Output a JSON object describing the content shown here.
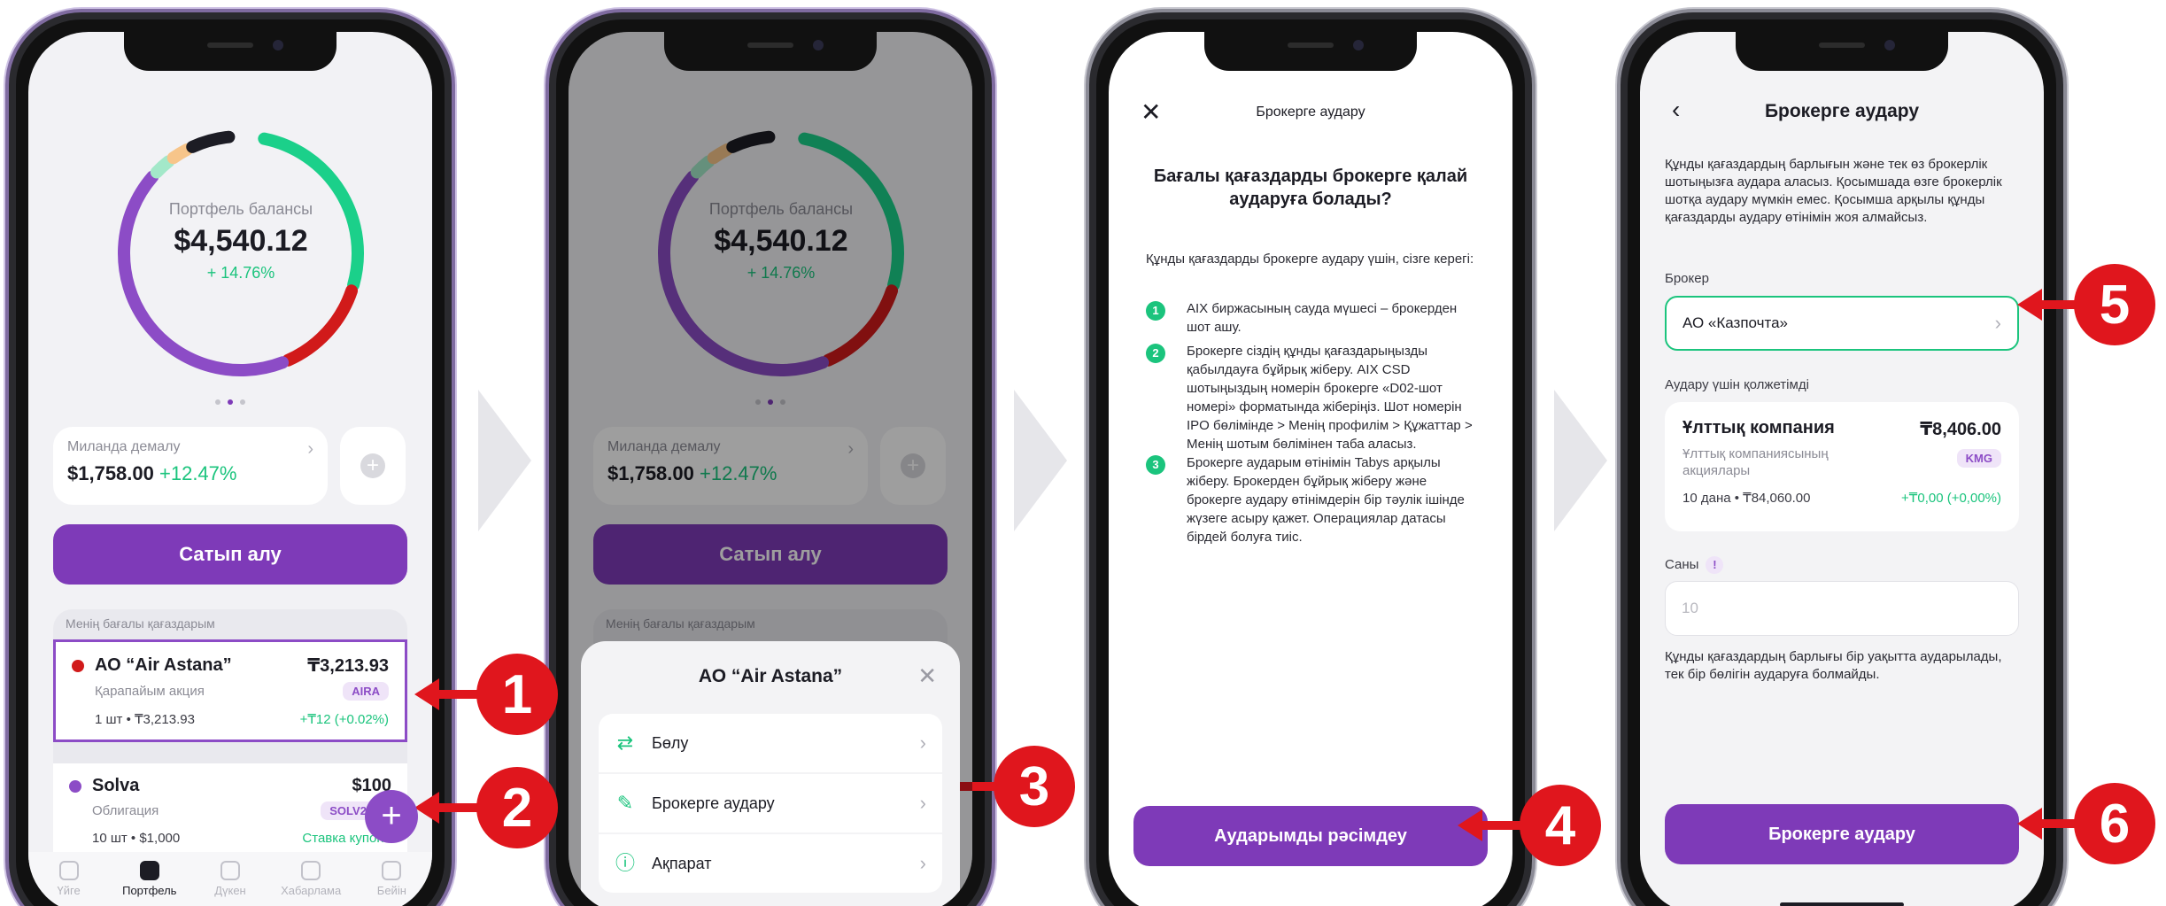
{
  "screen1": {
    "balance_label": "Портфель балансы",
    "balance_value": "$4,540.12",
    "balance_change": "+ 14.76%",
    "donut_segments": [
      {
        "color": "#1bd08a",
        "fraction": 0.27
      },
      {
        "color": "#d11a1a",
        "fraction": 0.14
      },
      {
        "color": "#8c4cc6",
        "fraction": 0.43
      },
      {
        "color": "#a3e8c9",
        "fraction": 0.03
      },
      {
        "color": "#f7c58a",
        "fraction": 0.03
      },
      {
        "color": "#1c1c24",
        "fraction": 0.06
      }
    ],
    "milanda_label": "Миланда демалу",
    "milanda_value": "$1,758.00",
    "milanda_change": "+12.47%",
    "buy_button": "Сатып алу",
    "section_title": "Менің бағалы қағаздарым",
    "items": [
      {
        "name": "АО “Air Astana”",
        "price": "₸3,213.93",
        "type": "Қарапайым акция",
        "tag": "AIRA",
        "qty": "1 шт • ₸3,213.93",
        "gain": "+₸12 (+0.02%)",
        "dot_color": "#d11a1a"
      },
      {
        "name": "Solva",
        "price": "$100",
        "type": "Облигация",
        "tag": "SOLV2.02",
        "qty": "10 шт • $1,000",
        "gain": "Ставка купона",
        "dot_color": "#8c4cc6"
      }
    ],
    "tabs": [
      "Үйге",
      "Портфель",
      "Дүкен",
      "Хабарлама",
      "Бейін"
    ]
  },
  "screen2": {
    "sheet_title": "АО “Air Astana”",
    "options": [
      {
        "label": "Бөлу",
        "icon": "shuffle-icon"
      },
      {
        "label": "Брокерге аудару",
        "icon": "edit-icon"
      },
      {
        "label": "Ақпарат",
        "icon": "info-icon"
      }
    ]
  },
  "screen3": {
    "title": "Брокерге аудару",
    "heading": "Бағалы қағаздарды брокерге қалай аударуға болады?",
    "intro": "Құнды қағаздарды брокерге аудару үшін, сізге керегі:",
    "steps": [
      "AIX биржасының сауда мүшесі – брокерден шот ашу.",
      "Брокерге сіздің құнды қағаздарыңызды қабылдауға бұйрық жіберу. AIX CSD шотыңыздың номерін брокерге «D02-шот номері» форматында жіберіңіз. Шот номерін IPO бөлімінде > Менің профилім > Құжаттар > Менің шотым бөлімінен таба аласыз.",
      "Брокерге аударым өтінімін Tabys арқылы жіберу. Брокерден бұйрық жіберу және брокерге аудару өтінімдерін бір тәулік ішінде жүзеге асыру қажет. Операциялар датасы бірдей болуға тиіс."
    ],
    "button": "Аударымды рәсімдеу"
  },
  "screen4": {
    "title": "Брокерге аудару",
    "description": "Құнды қағаздардың барлығын және тек өз брокерлік шотыңызға аудара аласыз. Қосымшада өзге брокерлік шотқа аудару мүмкін емес. Қосымша арқылы құнды қағаздарды аудару өтінімін жоя алмайсыз.",
    "broker_label": "Брокер",
    "broker_value": "АО «Казпочта»",
    "available_label": "Аудару үшін қолжетімді",
    "company_name": "Ұлттық компания",
    "company_price": "₸8,406.00",
    "company_sub": "Ұлттық компаниясының акциялары",
    "company_tag": "KMG",
    "company_qty": "10 дана • ₸84,060.00",
    "company_gain": "+₸0,00 (+0,00%)",
    "quantity_label": "Саны",
    "quantity_placeholder": "10",
    "note": "Құнды қағаздардың барлығы бір уақытта аударылады, тек бір бөлігін аударуға болмайды.",
    "button": "Брокерге аудару"
  },
  "callouts": [
    "1",
    "2",
    "3",
    "4",
    "5",
    "6"
  ],
  "colors": {
    "accent": "#7e3ab8",
    "positive": "#1bc47d",
    "callout": "#e0161d"
  }
}
